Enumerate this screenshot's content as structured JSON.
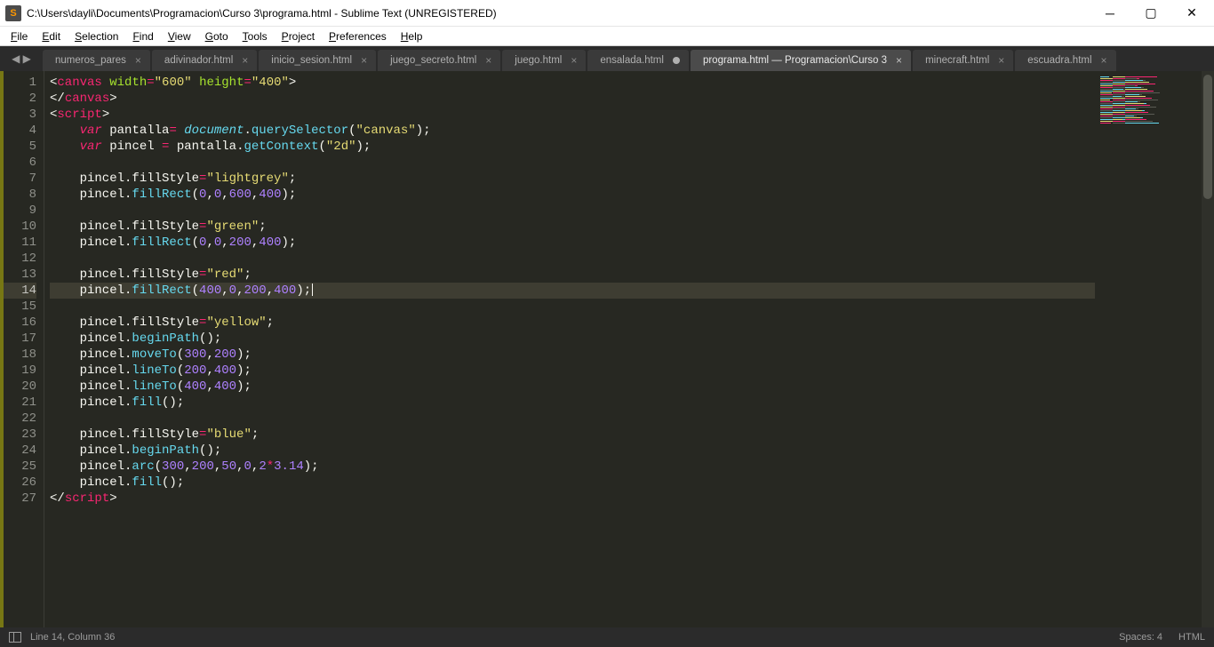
{
  "window": {
    "title": "C:\\Users\\dayli\\Documents\\Programacion\\Curso 3\\programa.html - Sublime Text (UNREGISTERED)"
  },
  "menu": {
    "items": [
      "File",
      "Edit",
      "Selection",
      "Find",
      "View",
      "Goto",
      "Tools",
      "Project",
      "Preferences",
      "Help"
    ]
  },
  "tabs": [
    {
      "label": "numeros_pares",
      "dirty": false,
      "active": false,
      "truncated": true
    },
    {
      "label": "adivinador.html",
      "dirty": false,
      "active": false
    },
    {
      "label": "inicio_sesion.html",
      "dirty": false,
      "active": false
    },
    {
      "label": "juego_secreto.html",
      "dirty": false,
      "active": false
    },
    {
      "label": "juego.html",
      "dirty": false,
      "active": false
    },
    {
      "label": "ensalada.html",
      "dirty": true,
      "active": false
    },
    {
      "label": "programa.html — Programacion\\Curso 3",
      "dirty": false,
      "active": true
    },
    {
      "label": "minecraft.html",
      "dirty": false,
      "active": false
    },
    {
      "label": "escuadra.html",
      "dirty": false,
      "active": false
    }
  ],
  "editor": {
    "line_count": 27,
    "current_line": 14
  },
  "status": {
    "position": "Line 14, Column 36",
    "spaces": "Spaces: 4",
    "syntax": "HTML"
  },
  "code_tokens": [
    [
      [
        "p",
        "<"
      ],
      [
        "t",
        "canvas"
      ],
      [
        "p",
        " "
      ],
      [
        "a",
        "width"
      ],
      [
        "o",
        "="
      ],
      [
        "s",
        "\"600\""
      ],
      [
        "p",
        " "
      ],
      [
        "a",
        "height"
      ],
      [
        "o",
        "="
      ],
      [
        "s",
        "\"400\""
      ],
      [
        "p",
        ">"
      ]
    ],
    [
      [
        "p",
        "</"
      ],
      [
        "t",
        "canvas"
      ],
      [
        "p",
        ">"
      ]
    ],
    [
      [
        "p",
        "<"
      ],
      [
        "t",
        "script"
      ],
      [
        "p",
        ">"
      ]
    ],
    [
      [
        "p",
        "    "
      ],
      [
        "k",
        "var"
      ],
      [
        "p",
        " "
      ],
      [
        "v",
        "pantalla"
      ],
      [
        "o",
        "= "
      ],
      [
        "st",
        "document"
      ],
      [
        "p",
        "."
      ],
      [
        "f",
        "querySelector"
      ],
      [
        "p",
        "("
      ],
      [
        "s",
        "\"canvas\""
      ],
      [
        "p",
        ");"
      ]
    ],
    [
      [
        "p",
        "    "
      ],
      [
        "k",
        "var"
      ],
      [
        "p",
        " "
      ],
      [
        "v",
        "pincel "
      ],
      [
        "o",
        "="
      ],
      [
        "p",
        " pantalla."
      ],
      [
        "f",
        "getContext"
      ],
      [
        "p",
        "("
      ],
      [
        "s",
        "\"2d\""
      ],
      [
        "p",
        ");"
      ]
    ],
    [],
    [
      [
        "p",
        "    pincel.fillStyle"
      ],
      [
        "o",
        "="
      ],
      [
        "s",
        "\"lightgrey\""
      ],
      [
        "p",
        ";"
      ]
    ],
    [
      [
        "p",
        "    pincel."
      ],
      [
        "f",
        "fillRect"
      ],
      [
        "p",
        "("
      ],
      [
        "n",
        "0"
      ],
      [
        "p",
        ","
      ],
      [
        "n",
        "0"
      ],
      [
        "p",
        ","
      ],
      [
        "n",
        "600"
      ],
      [
        "p",
        ","
      ],
      [
        "n",
        "400"
      ],
      [
        "p",
        ");"
      ]
    ],
    [],
    [
      [
        "p",
        "    pincel.fillStyle"
      ],
      [
        "o",
        "="
      ],
      [
        "s",
        "\"green\""
      ],
      [
        "p",
        ";"
      ]
    ],
    [
      [
        "p",
        "    pincel."
      ],
      [
        "f",
        "fillRect"
      ],
      [
        "p",
        "("
      ],
      [
        "n",
        "0"
      ],
      [
        "p",
        ","
      ],
      [
        "n",
        "0"
      ],
      [
        "p",
        ","
      ],
      [
        "n",
        "200"
      ],
      [
        "p",
        ","
      ],
      [
        "n",
        "400"
      ],
      [
        "p",
        ");"
      ]
    ],
    [],
    [
      [
        "p",
        "    pincel.fillStyle"
      ],
      [
        "o",
        "="
      ],
      [
        "s",
        "\"red\""
      ],
      [
        "p",
        ";"
      ]
    ],
    [
      [
        "p",
        "    pincel."
      ],
      [
        "f",
        "fillRect"
      ],
      [
        "p",
        "("
      ],
      [
        "n",
        "400"
      ],
      [
        "p",
        ","
      ],
      [
        "n",
        "0"
      ],
      [
        "p",
        ","
      ],
      [
        "n",
        "200"
      ],
      [
        "p",
        ","
      ],
      [
        "n",
        "400"
      ],
      [
        "p",
        ");"
      ],
      [
        "cursor",
        ""
      ]
    ],
    [],
    [
      [
        "p",
        "    pincel.fillStyle"
      ],
      [
        "o",
        "="
      ],
      [
        "s",
        "\"yellow\""
      ],
      [
        "p",
        ";"
      ]
    ],
    [
      [
        "p",
        "    pincel."
      ],
      [
        "f",
        "beginPath"
      ],
      [
        "p",
        "();"
      ]
    ],
    [
      [
        "p",
        "    pincel."
      ],
      [
        "f",
        "moveTo"
      ],
      [
        "p",
        "("
      ],
      [
        "n",
        "300"
      ],
      [
        "p",
        ","
      ],
      [
        "n",
        "200"
      ],
      [
        "p",
        ");"
      ]
    ],
    [
      [
        "p",
        "    pincel."
      ],
      [
        "f",
        "lineTo"
      ],
      [
        "p",
        "("
      ],
      [
        "n",
        "200"
      ],
      [
        "p",
        ","
      ],
      [
        "n",
        "400"
      ],
      [
        "p",
        ");"
      ]
    ],
    [
      [
        "p",
        "    pincel."
      ],
      [
        "f",
        "lineTo"
      ],
      [
        "p",
        "("
      ],
      [
        "n",
        "400"
      ],
      [
        "p",
        ","
      ],
      [
        "n",
        "400"
      ],
      [
        "p",
        ");"
      ]
    ],
    [
      [
        "p",
        "    pincel."
      ],
      [
        "f",
        "fill"
      ],
      [
        "p",
        "();"
      ]
    ],
    [],
    [
      [
        "p",
        "    pincel.fillStyle"
      ],
      [
        "o",
        "="
      ],
      [
        "s",
        "\"blue\""
      ],
      [
        "p",
        ";"
      ]
    ],
    [
      [
        "p",
        "    pincel."
      ],
      [
        "f",
        "beginPath"
      ],
      [
        "p",
        "();"
      ]
    ],
    [
      [
        "p",
        "    pincel."
      ],
      [
        "f",
        "arc"
      ],
      [
        "p",
        "("
      ],
      [
        "n",
        "300"
      ],
      [
        "p",
        ","
      ],
      [
        "n",
        "200"
      ],
      [
        "p",
        ","
      ],
      [
        "n",
        "50"
      ],
      [
        "p",
        ","
      ],
      [
        "n",
        "0"
      ],
      [
        "p",
        ","
      ],
      [
        "n",
        "2"
      ],
      [
        "o",
        "*"
      ],
      [
        "n",
        "3.14"
      ],
      [
        "p",
        ");"
      ]
    ],
    [
      [
        "p",
        "    pincel."
      ],
      [
        "f",
        "fill"
      ],
      [
        "p",
        "();"
      ]
    ],
    [
      [
        "p",
        "</"
      ],
      [
        "t",
        "script"
      ],
      [
        "p",
        ">"
      ]
    ]
  ]
}
